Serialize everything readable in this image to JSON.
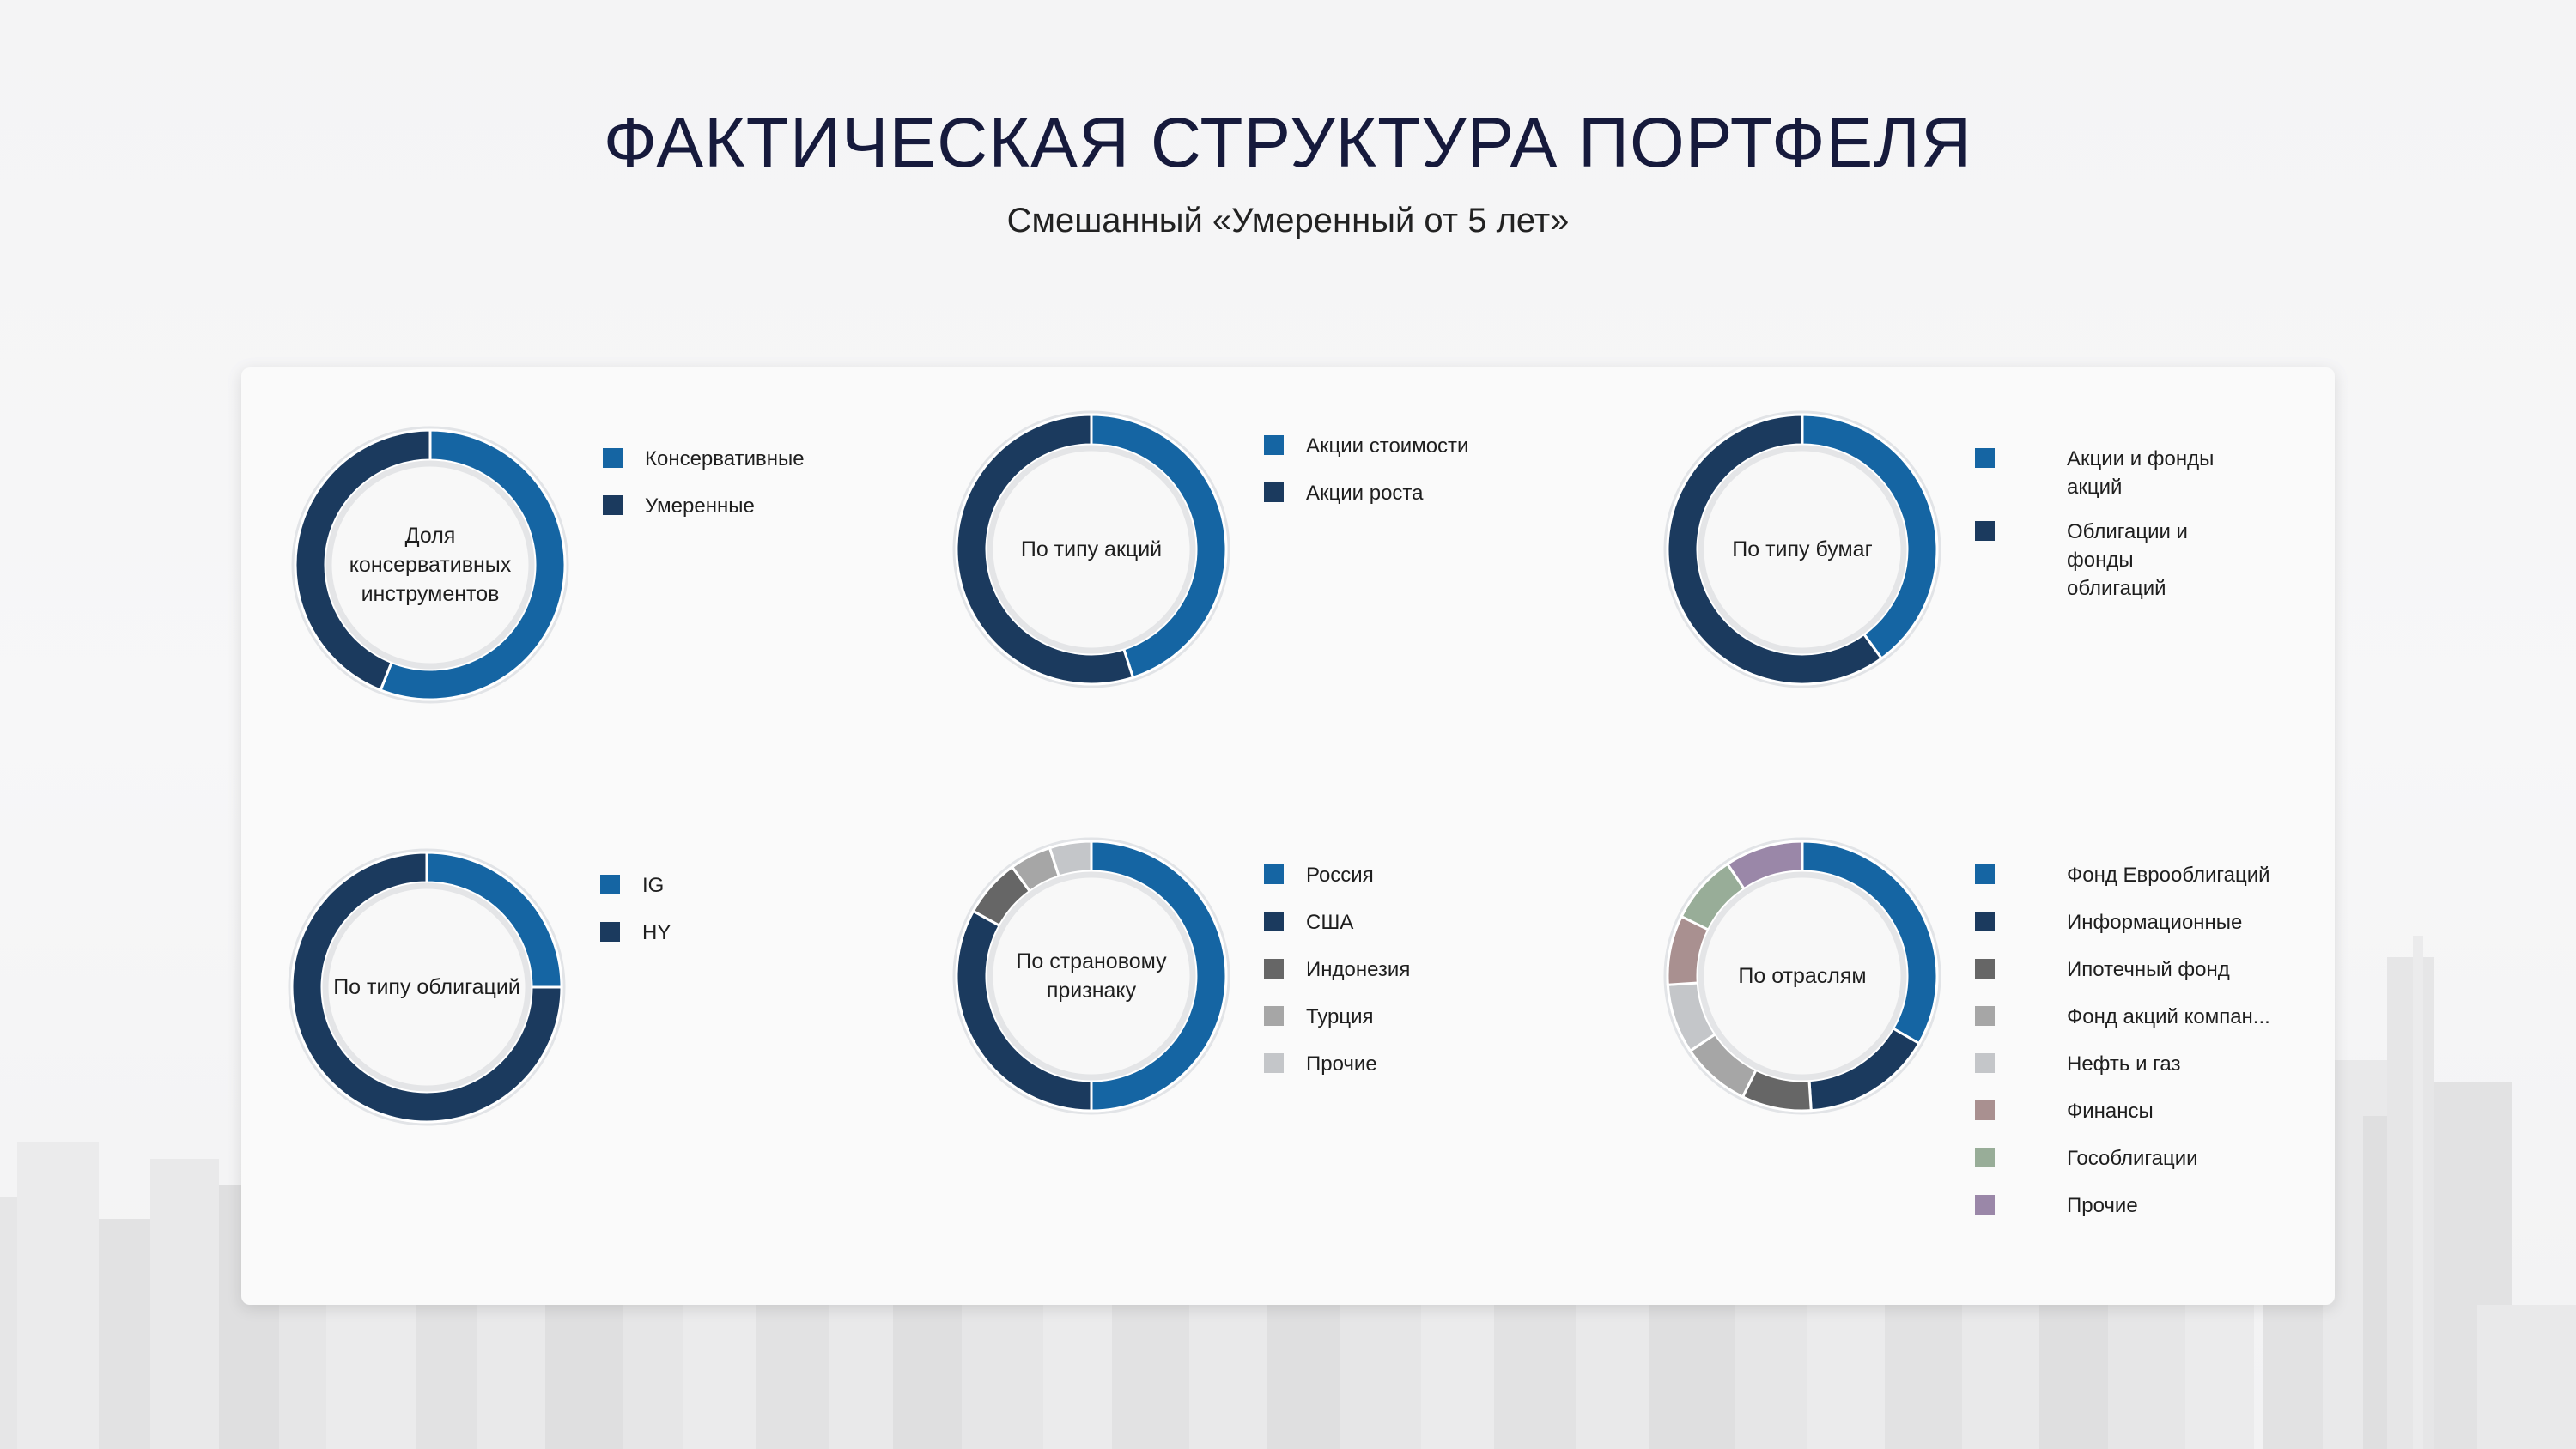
{
  "title": "ФАКТИЧЕСКАЯ СТРУКТУРА ПОРТФЕЛЯ",
  "subtitle": "Смешанный «Умеренный от 5 лет»",
  "colors": {
    "blue": "#1565a3",
    "navy": "#1b3a5e",
    "darkgray": "#666666",
    "gray": "#a6a6a6",
    "lightgray": "#c4c6c9",
    "mauve": "#a99090",
    "sage": "#98ad98",
    "purple": "#9a87a8"
  },
  "chart_data": [
    {
      "type": "pie",
      "center_label": "Доля консервативных инструментов",
      "categories": [
        "Консервативные",
        "Умеренные"
      ],
      "values": [
        56,
        44
      ],
      "colors": [
        "#1565a3",
        "#1b3a5e"
      ]
    },
    {
      "type": "pie",
      "center_label": "По типу акций",
      "categories": [
        "Акции стоимости",
        "Акции роста"
      ],
      "values": [
        45,
        55
      ],
      "colors": [
        "#1565a3",
        "#1b3a5e"
      ]
    },
    {
      "type": "pie",
      "center_label": "По типу бумаг",
      "categories": [
        "Акции и фонды акций",
        "Облигации и фонды облигаций"
      ],
      "values": [
        40,
        60
      ],
      "colors": [
        "#1565a3",
        "#1b3a5e"
      ]
    },
    {
      "type": "pie",
      "center_label": "По типу облигаций",
      "categories": [
        "IG",
        "HY"
      ],
      "values": [
        25,
        75
      ],
      "colors": [
        "#1565a3",
        "#1b3a5e"
      ]
    },
    {
      "type": "pie",
      "center_label": "По страновому признаку",
      "categories": [
        "Россия",
        "США",
        "Индонезия",
        "Турция",
        "Прочие"
      ],
      "values": [
        50,
        33,
        7,
        5,
        5
      ],
      "colors": [
        "#1565a3",
        "#1b3a5e",
        "#666666",
        "#a6a6a6",
        "#c4c6c9"
      ]
    },
    {
      "type": "pie",
      "center_label": "По отраслям",
      "categories": [
        "Фонд Еврооблигаций",
        "Информационные",
        "Ипотечный фонд",
        "Фонд акций компан...",
        "Нефть и газ",
        "Финансы",
        "Гособлигации",
        "Прочие"
      ],
      "values": [
        32,
        15,
        8,
        8,
        8,
        8,
        8,
        9
      ],
      "colors": [
        "#1565a3",
        "#1b3a5e",
        "#666666",
        "#a6a6a6",
        "#c4c6c9",
        "#a99090",
        "#98ad98",
        "#9a87a8"
      ]
    }
  ]
}
